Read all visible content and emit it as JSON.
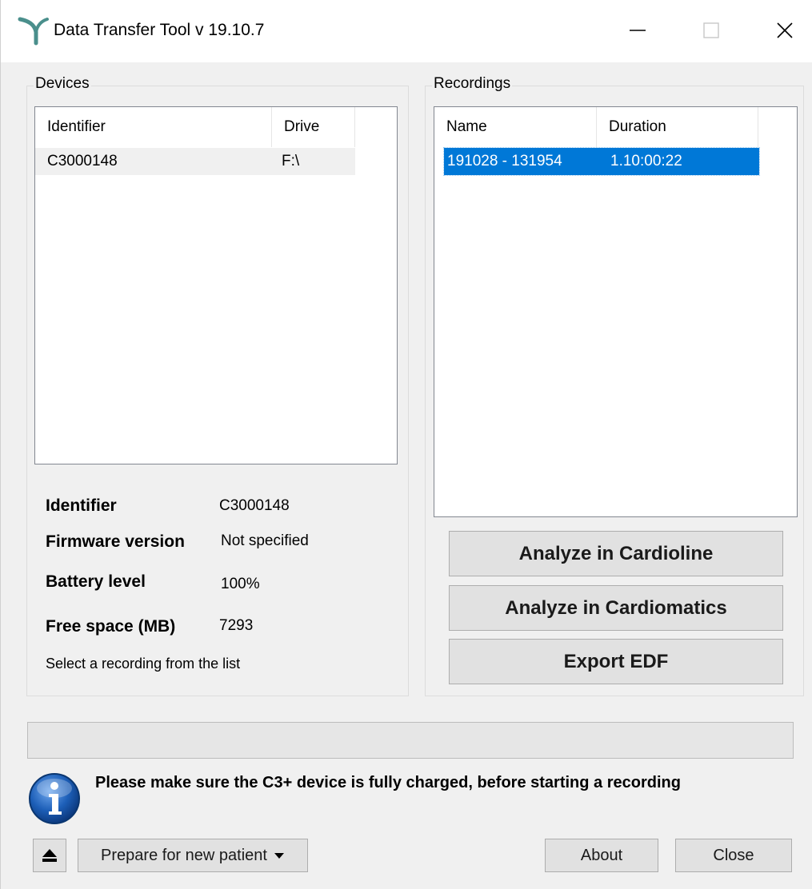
{
  "window": {
    "title": "Data Transfer Tool v 19.10.7",
    "icon": "app-logo-icon",
    "controls": [
      "minimize-icon",
      "maximize-icon",
      "close-icon"
    ]
  },
  "devices": {
    "group_title": "Devices",
    "columns": [
      "Identifier",
      "Drive"
    ],
    "rows": [
      {
        "identifier": "C3000148",
        "drive": "F:\\"
      }
    ]
  },
  "device_info": {
    "identifier_label": "Identifier",
    "identifier_value": "C3000148",
    "firmware_label": "Firmware version",
    "firmware_value": "Not specified",
    "battery_label": "Battery level",
    "battery_value": "100%",
    "free_space_label": "Free space (MB)",
    "free_space_value": "7293",
    "hint": "Select a recording from the list"
  },
  "recordings": {
    "group_title": "Recordings",
    "columns": [
      "Name",
      "Duration"
    ],
    "rows": [
      {
        "name": "191028 - 131954",
        "duration": "1.10:00:22",
        "selected": true
      }
    ]
  },
  "actions": {
    "cardioline_label": "Analyze in Cardioline",
    "cardiomatics_label": "Analyze in Cardiomatics",
    "export_label": "Export EDF"
  },
  "progress": {
    "fraction": 0.0
  },
  "notice": {
    "icon": "info-icon",
    "text": "Please make sure the C3+ device is fully charged, before starting a recording"
  },
  "footer": {
    "eject_icon": "eject-icon",
    "prepare_label": "Prepare for new patient",
    "about_label": "About",
    "close_label": "Close"
  },
  "colors": {
    "selection": "#0078d7",
    "row_hover": "#f0f0f0",
    "button_face": "#e1e1e1",
    "info_blue": "#1d5fb8"
  }
}
